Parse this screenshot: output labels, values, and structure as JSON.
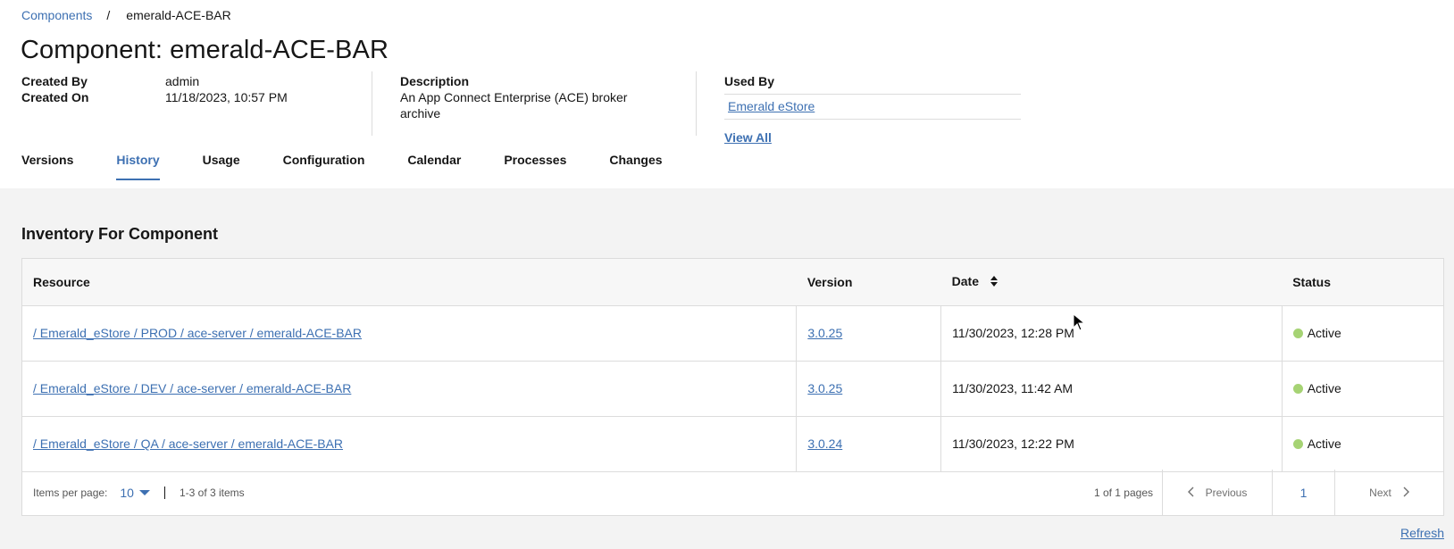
{
  "breadcrumb": {
    "parent": "Components",
    "separator": "/",
    "current": "emerald-ACE-BAR"
  },
  "page_title": "Component: emerald-ACE-BAR",
  "meta": {
    "created_by_label": "Created By",
    "created_by_value": "admin",
    "created_on_label": "Created On",
    "created_on_value": "11/18/2023, 10:57 PM",
    "description_label": "Description",
    "description_value": "An App Connect Enterprise (ACE) broker archive",
    "used_by_label": "Used By",
    "used_by_link": "Emerald eStore",
    "view_all": "View All"
  },
  "tabs": [
    {
      "label": "Versions",
      "active": false
    },
    {
      "label": "History",
      "active": true
    },
    {
      "label": "Usage",
      "active": false
    },
    {
      "label": "Configuration",
      "active": false
    },
    {
      "label": "Calendar",
      "active": false
    },
    {
      "label": "Processes",
      "active": false
    },
    {
      "label": "Changes",
      "active": false
    }
  ],
  "inventory": {
    "title": "Inventory For Component",
    "columns": {
      "resource": "Resource",
      "version": "Version",
      "date": "Date",
      "status": "Status"
    },
    "rows": [
      {
        "resource": "/ Emerald_eStore / PROD / ace-server / emerald-ACE-BAR",
        "version": "3.0.25",
        "date": "11/30/2023, 12:28 PM",
        "status": "Active"
      },
      {
        "resource": "/ Emerald_eStore / DEV / ace-server / emerald-ACE-BAR",
        "version": "3.0.25",
        "date": "11/30/2023, 11:42 AM",
        "status": "Active"
      },
      {
        "resource": "/ Emerald_eStore / QA / ace-server / emerald-ACE-BAR",
        "version": "3.0.24",
        "date": "11/30/2023, 12:22 PM",
        "status": "Active"
      }
    ],
    "status_color": "#a6d374"
  },
  "pagination": {
    "items_per_page_label": "Items per page:",
    "items_per_page_value": "10",
    "range": "1-3 of 3 items",
    "pages_text": "1 of 1 pages",
    "previous": "Previous",
    "current_page": "1",
    "next": "Next"
  },
  "refresh": "Refresh",
  "colors": {
    "accent": "#3d70b2",
    "panel_bg": "#f3f3f3",
    "status_active": "#a6d374"
  }
}
